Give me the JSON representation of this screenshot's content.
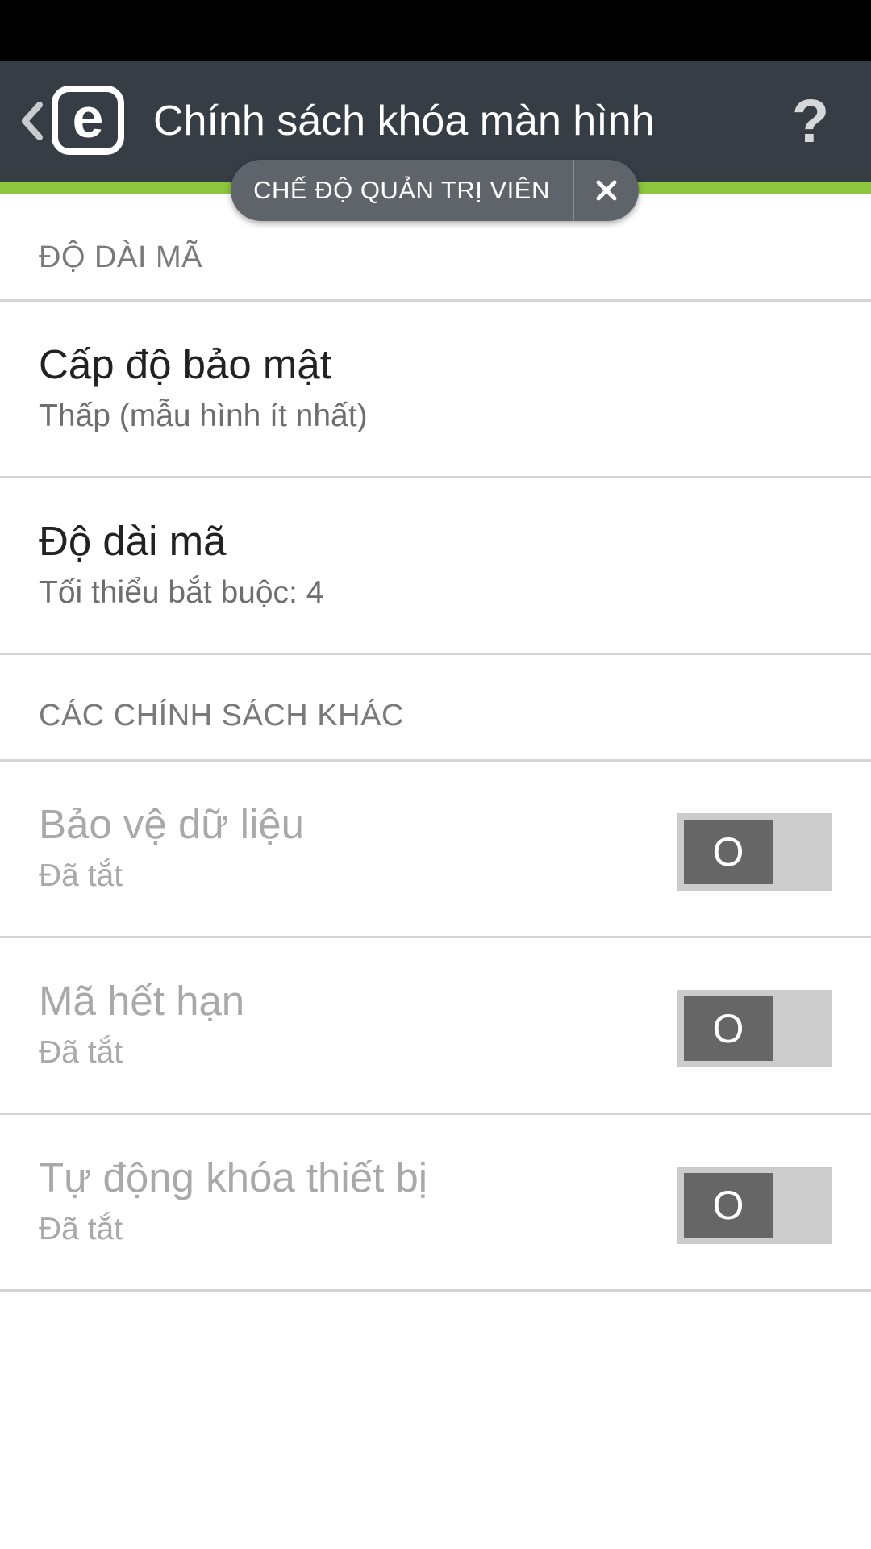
{
  "app_bar": {
    "title": "Chính sách khóa màn hình",
    "logo_letter": "e",
    "help_glyph": "?",
    "back_icon": "chevron-left-icon",
    "help_icon": "question-mark-icon"
  },
  "admin_mode": {
    "label": "CHẾ ĐỘ QUẢN TRỊ VIÊN",
    "close_icon": "close-icon"
  },
  "sections": {
    "code_length_header": "ĐỘ DÀI MÃ",
    "other_policies_header": "CÁC CHÍNH SÁCH KHÁC"
  },
  "settings": {
    "security_level": {
      "title": "Cấp độ bảo mật",
      "subtitle": "Thấp (mẫu hình ít nhất)"
    },
    "code_length": {
      "title": "Độ dài mã",
      "subtitle": "Tối thiểu bắt buộc: 4"
    },
    "data_protection": {
      "title": "Bảo vệ dữ liệu",
      "subtitle": "Đã tắt",
      "toggle_label": "O",
      "enabled": false
    },
    "code_expiration": {
      "title": "Mã hết hạn",
      "subtitle": "Đã tắt",
      "toggle_label": "O",
      "enabled": false
    },
    "auto_lock": {
      "title": "Tự động khóa thiết bị",
      "subtitle": "Đã tắt",
      "toggle_label": "O",
      "enabled": false
    }
  },
  "colors": {
    "status_bar": "#000000",
    "app_bar": "#373d45",
    "accent_green": "#8dc63f",
    "pill": "#5f646b",
    "toggle_track": "#cccccc",
    "toggle_knob": "#666666"
  }
}
